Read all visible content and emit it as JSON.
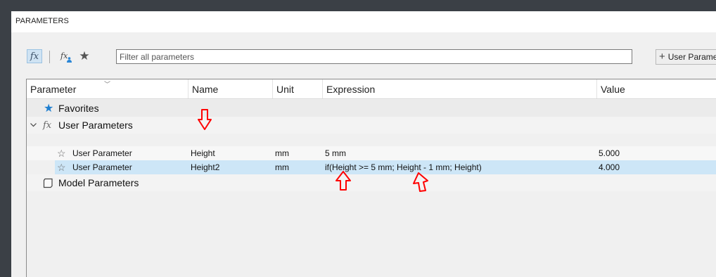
{
  "window": {
    "title": "PARAMETERS"
  },
  "toolbar": {
    "search_placeholder": "Filter all parameters",
    "add_button_label": "User Parame"
  },
  "table": {
    "columns": [
      "Parameter",
      "Name",
      "Unit",
      "Expression",
      "Value"
    ],
    "groups": [
      {
        "label": "Favorites",
        "icon": "star-icon"
      },
      {
        "label": "User Parameters",
        "icon": "fx-icon",
        "expanded": true
      },
      {
        "label": "Model Parameters",
        "icon": "cube-icon"
      }
    ],
    "rows": [
      {
        "parameter": "User Parameter",
        "name": "Height",
        "unit": "mm",
        "expression": "5 mm",
        "value": "5.000",
        "selected": false
      },
      {
        "parameter": "User Parameter",
        "name": "Height2",
        "unit": "mm",
        "expression": "if(Height >= 5 mm; Height - 1 mm; Height)",
        "value": "4.000",
        "selected": true
      }
    ]
  },
  "colors": {
    "selection": "#cde6f7",
    "annotation": "#ff0000",
    "star_blue": "#1f7fd0"
  }
}
